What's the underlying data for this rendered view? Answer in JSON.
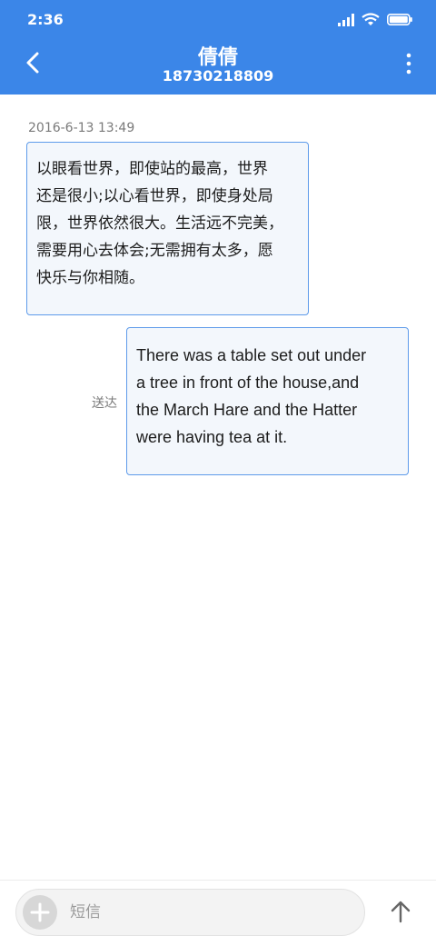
{
  "status_bar": {
    "time": "2:36"
  },
  "header": {
    "contact_name": "倩倩",
    "phone_number": "18730218809"
  },
  "conversation": {
    "timestamp": "2016-6-13 13:49",
    "messages": [
      {
        "direction": "incoming",
        "lines": [
          "以眼看世界，即使站的最高，世界",
          "还是很小;以心看世界，即使身处局",
          "限，世界依然很大。生活远不完美，",
          "需要用心去体会;无需拥有太多，愿",
          "快乐与你相随。"
        ]
      },
      {
        "direction": "outgoing",
        "status": "送达",
        "lines": [
          "There was a table set out under",
          "a tree in front of the house,and",
          "the March Hare and the Hatter",
          "were having tea at it."
        ]
      }
    ]
  },
  "composer": {
    "placeholder": "短信",
    "value": ""
  },
  "icons": {
    "back": "back-arrow-icon",
    "menu": "more-vertical-icon",
    "add": "plus-icon",
    "send": "send-arrow-up-icon"
  },
  "colors": {
    "header": "#3B86E8",
    "bubble_border": "#5E9BEA",
    "bubble_fill": "#F3F7FC"
  }
}
